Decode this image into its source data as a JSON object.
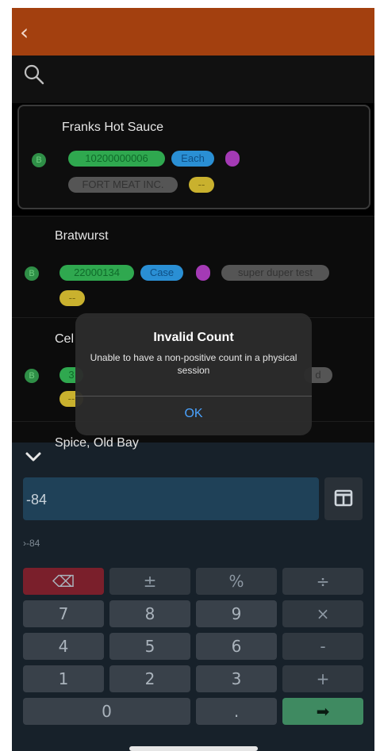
{
  "header": {
    "back_icon": "chevron-left-icon"
  },
  "search": {
    "icon": "search-icon"
  },
  "items": [
    {
      "name": "Franks Hot Sauce",
      "status": "B",
      "code": "10200000006",
      "unit": "Each",
      "vendor": "FORT MEAT INC.",
      "extra": "--"
    },
    {
      "name": "Bratwurst",
      "status": "B",
      "code": "22000134",
      "unit": "Case",
      "vendor": "super duper test",
      "extra": "--"
    },
    {
      "name": "Cel",
      "status": "B",
      "code": "3",
      "vendor": "d",
      "extra": "--"
    },
    {
      "name": "Spice, Old Bay"
    }
  ],
  "dialog": {
    "title": "Invalid Count",
    "message": "Unable to have a non-positive count in a physical session",
    "ok_label": "OK"
  },
  "keypad": {
    "display_value": "-84",
    "expression": "›-84",
    "keys": {
      "delete": "⌫",
      "plusminus": "±",
      "percent": "%",
      "divide": "÷",
      "seven": "7",
      "eight": "8",
      "nine": "9",
      "multiply": "×",
      "four": "4",
      "five": "5",
      "six": "6",
      "minus": "-",
      "one": "1",
      "two": "2",
      "three": "3",
      "plus": "+",
      "zero": "0",
      "dot": ".",
      "enter": "➡"
    }
  },
  "colors": {
    "header": "#a3400f",
    "accent_blue": "#4aa3ff",
    "enter_green": "#3f8a61",
    "delete_red": "#7a1f2b"
  }
}
